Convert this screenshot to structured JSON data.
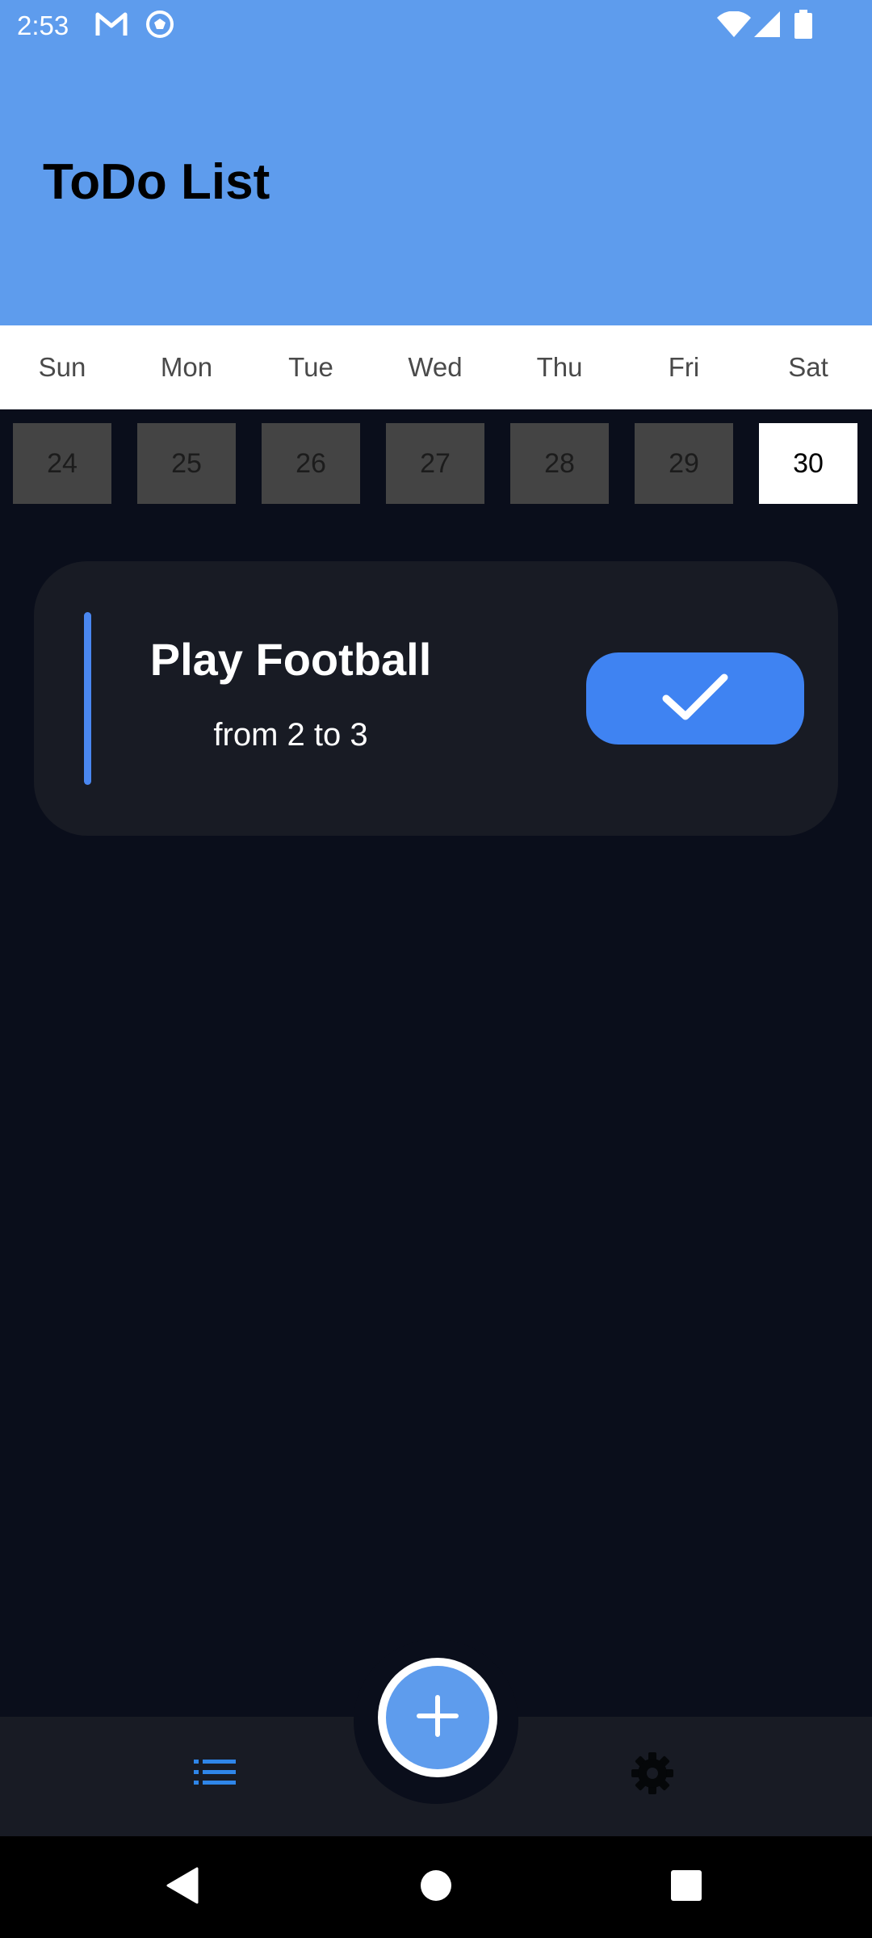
{
  "status_bar": {
    "time": "2:53",
    "left_icons": [
      "gmail-icon",
      "soccer-ball-icon"
    ],
    "right_icons": [
      "wifi-icon",
      "signal-icon",
      "battery-icon"
    ]
  },
  "header": {
    "title": "ToDo List",
    "background": "#5e9ced"
  },
  "calendar": {
    "weekdays": [
      "Sun",
      "Mon",
      "Tue",
      "Wed",
      "Thu",
      "Fri",
      "Sat"
    ],
    "dates": [
      "24",
      "25",
      "26",
      "27",
      "28",
      "29",
      "30"
    ],
    "selected_date": "30"
  },
  "tasks": [
    {
      "title": "Play Football",
      "time": "from 2 to 3",
      "accent_color": "#4a87f0",
      "action_icon": "checkmark-icon"
    }
  ],
  "bottom_nav": {
    "items": [
      "list-icon",
      "gear-icon"
    ],
    "active": "list-icon",
    "active_color": "#2f86e9",
    "fab_icon": "plus-icon"
  },
  "system_nav": [
    "back-icon",
    "home-icon",
    "recents-icon"
  ]
}
